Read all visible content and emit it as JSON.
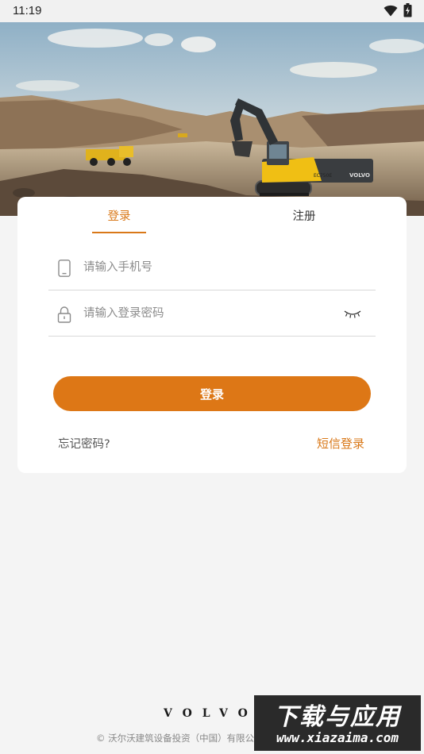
{
  "status_bar": {
    "time": "11:19",
    "wifi_icon": "wifi-icon",
    "battery_icon": "battery-charging-icon"
  },
  "hero": {
    "image": "volvo-excavator-quarry-photo",
    "excavator_badge": "VOLVO",
    "excavator_model": "EC750E"
  },
  "login_card": {
    "tabs": [
      {
        "label": "登录",
        "active": true
      },
      {
        "label": "注册",
        "active": false
      }
    ],
    "phone_field": {
      "placeholder": "请输入手机号",
      "value": "",
      "icon": "mobile-phone-icon"
    },
    "password_field": {
      "placeholder": "请输入登录密码",
      "value": "",
      "icon": "lock-icon",
      "toggle_icon": "eye-closed-icon"
    },
    "login_button": "登录",
    "forgot_password": "忘记密码?",
    "sms_login": "短信登录"
  },
  "footer": {
    "brand": "VOLVO",
    "copyright": "© 沃尔沃建筑设备投资（中国）有限公司"
  },
  "watermark": {
    "title": "下载与应用",
    "url": "www.xiazaima.com"
  },
  "colors": {
    "accent": "#dd7716",
    "card": "#ffffff",
    "background": "#f4f4f4"
  }
}
